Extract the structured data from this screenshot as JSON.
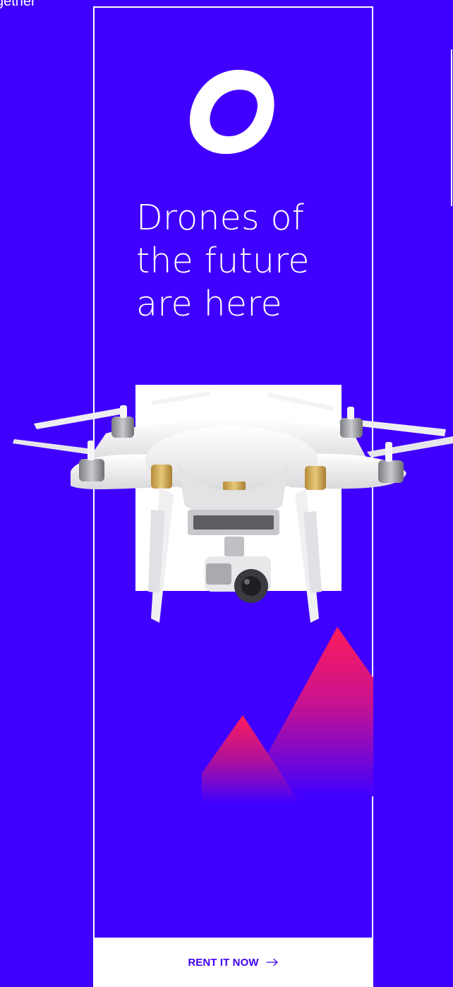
{
  "left_caption": "gether",
  "banner": {
    "headline_lines": [
      "Drones of",
      "the future",
      "are here"
    ],
    "cta_label": "RENT IT NOW",
    "cta_icon": "arrow-right-icon",
    "logo_icon": "ring-logo-icon"
  },
  "colors": {
    "background": "#4000ff",
    "frame": "#ffffff",
    "cta_text": "#4200f5",
    "mountain_top": "#ff1c5b",
    "mountain_bottom": "#4000ff"
  }
}
